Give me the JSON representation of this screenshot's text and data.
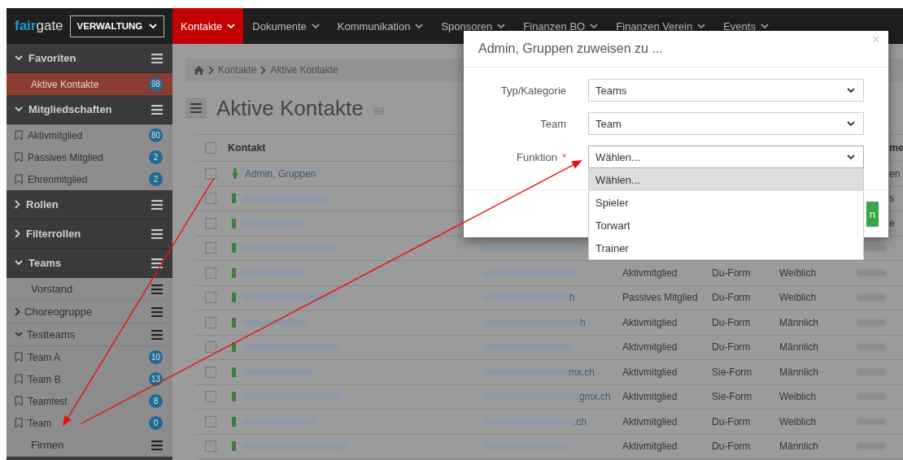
{
  "navbar": {
    "logo": {
      "part_1": "fair",
      "part_2": "gate"
    },
    "module_selector": "VERWALTUNG",
    "menus": [
      {
        "label": "Kontakte",
        "selected": true
      },
      {
        "label": "Dokumente",
        "selected": false
      },
      {
        "label": "Kommunikation",
        "selected": false
      },
      {
        "label": "Sponsoren",
        "selected": false
      },
      {
        "label": "Finanzen BO",
        "selected": false
      },
      {
        "label": "Finanzen Verein",
        "selected": false
      },
      {
        "label": "Events",
        "selected": false
      }
    ]
  },
  "sidebar": {
    "sections": [
      {
        "title": "Favoriten",
        "expanded": true,
        "items": [
          {
            "kind": "plain",
            "label": "Aktive Kontakte",
            "count": "98",
            "selected": true
          }
        ]
      },
      {
        "title": "Mitgliedschaften",
        "expanded": true,
        "items": [
          {
            "kind": "bookmark",
            "label": "Aktivmitglied",
            "count": "80",
            "selected": false
          },
          {
            "kind": "bookmark",
            "label": "Passives Mitglied",
            "count": "2",
            "selected": false
          },
          {
            "kind": "bookmark",
            "label": "Ehrenmitglied",
            "count": "2",
            "selected": false
          }
        ]
      },
      {
        "title": "Rollen",
        "expanded": false
      },
      {
        "title": "Filterrollen",
        "expanded": false
      },
      {
        "title": "Teams",
        "expanded": true,
        "items": [
          {
            "kind": "group",
            "label": "Vorstand",
            "selected": false
          },
          {
            "kind": "folder",
            "label": "Choreogruppe",
            "expanded": false,
            "selected": false
          },
          {
            "kind": "folder",
            "label": "Testteams",
            "expanded": true,
            "selected": false,
            "children": [
              {
                "kind": "bookmark",
                "label": "Team A",
                "count": "10",
                "selected": false
              },
              {
                "kind": "bookmark",
                "label": "Team B",
                "count": "13",
                "selected": false
              },
              {
                "kind": "bookmark",
                "label": "Teamtest",
                "count": "8",
                "selected": false
              },
              {
                "kind": "bookmark",
                "label": "Team",
                "count": "0",
                "selected": false
              }
            ]
          },
          {
            "kind": "group",
            "label": "Firmen",
            "selected": false
          }
        ]
      }
    ]
  },
  "main": {
    "breadcrumb": [
      "Kontakte",
      "Aktive Kontakte"
    ],
    "title": "Aktive Kontakte",
    "count": "98",
    "table": {
      "select_all_checked": false,
      "columns": [
        {
          "label": "Kontakt"
        },
        {
          "label": "me"
        }
      ],
      "rows": [
        {
          "checked": false,
          "contact": "Admin, Gruppen",
          "column_6": "en"
        },
        {
          "checked": false,
          "column_6": "s"
        },
        {
          "checked": false,
          "column_6": "e"
        },
        {
          "checked": false
        },
        {
          "checked": false,
          "membership": "Aktivmitglied",
          "salutation": "Du-Form",
          "gender": "Weiblich"
        },
        {
          "checked": false,
          "email_fragment": "h",
          "membership": "Passives Mitglied",
          "salutation": "Du-Form",
          "gender": "Weiblich"
        },
        {
          "checked": false,
          "email_fragment": "h",
          "membership": "Aktivmitglied",
          "salutation": "Du-Form",
          "gender": "Männlich"
        },
        {
          "checked": false,
          "membership": "Aktivmitglied",
          "salutation": "Du-Form",
          "gender": "Männlich"
        },
        {
          "checked": false,
          "email_fragment": "mx.ch",
          "membership": "Aktivmitglied",
          "salutation": "Sie-Form",
          "gender": "Männlich"
        },
        {
          "checked": false,
          "email_fragment": "gmx.ch",
          "membership": "Aktivmitglied",
          "salutation": "Sie-Form",
          "gender": "Weiblich"
        },
        {
          "checked": false,
          "email_fragment": ".ch",
          "membership": "Aktivmitglied",
          "salutation": "Du-Form",
          "gender": "Weiblich"
        },
        {
          "checked": false,
          "membership": "Aktivmitglied",
          "salutation": "Du-Form",
          "gender": "Männlich"
        }
      ]
    }
  },
  "modal": {
    "title": "Admin, Gruppen zuweisen zu ...",
    "close": "×",
    "fields": [
      {
        "label": "Typ/Kategorie",
        "value": "Teams",
        "expanded": false
      },
      {
        "label": "Team",
        "value": "Team",
        "expanded": false
      },
      {
        "label": "Funktion",
        "required_mark": "*",
        "value": "Wählen...",
        "expanded": true,
        "options": [
          {
            "label": "Wählen...",
            "selected": true
          },
          {
            "label": "Spieler",
            "selected": false
          },
          {
            "label": "Torwart",
            "selected": false
          },
          {
            "label": "Trainer",
            "selected": false
          }
        ]
      }
    ],
    "footer_button": "n"
  }
}
